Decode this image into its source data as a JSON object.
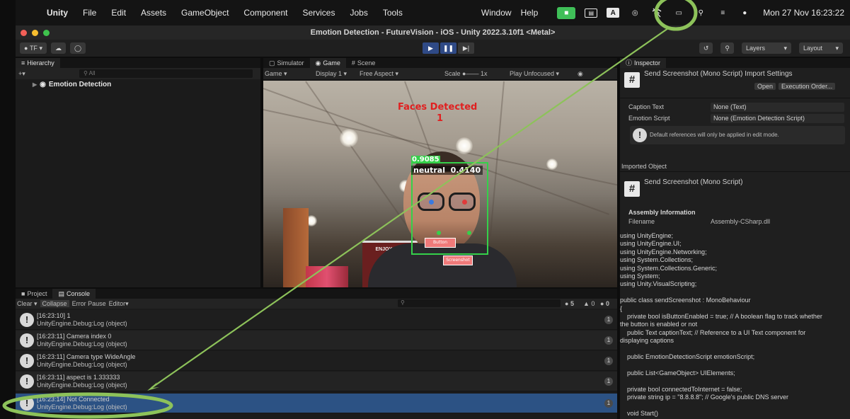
{
  "menubar": {
    "app": "Unity",
    "items": [
      "File",
      "Edit",
      "Assets",
      "GameObject",
      "Component",
      "Services",
      "Jobs",
      "Tools"
    ],
    "right_items": [
      "Window",
      "Help"
    ],
    "clock": "Mon 27 Nov  16:23:22"
  },
  "window": {
    "title": "Emotion Detection - FutureVision - iOS - Unity 2022.3.10f1 <Metal>"
  },
  "toolbar": {
    "account": "TF",
    "layers": "Layers",
    "layout": "Layout"
  },
  "hierarchy": {
    "tab": "Hierarchy",
    "search_placeholder": "All",
    "root_item": "Emotion Detection"
  },
  "game": {
    "tabs": [
      "Simulator",
      "Game",
      "Scene"
    ],
    "display_mode": "Game",
    "display": "Display 1",
    "aspect": "Free Aspect",
    "scale_label": "Scale",
    "scale_value": "1x",
    "play_mode": "Play Unfocused",
    "faces_detected_label": "Faces Detected",
    "faces_detected_count": "1",
    "face_score": "0.9085",
    "emotion": "neutral",
    "emotion_score": "0.4140",
    "button1": "Button",
    "button2": "Screenshot",
    "store_sign": "ENJOY OUR"
  },
  "console": {
    "tabs": [
      "Project",
      "Console"
    ],
    "toolbar": {
      "clear": "Clear",
      "collapse": "Collapse",
      "error_pause": "Error Pause",
      "editor": "Editor"
    },
    "counts": {
      "logs": "5",
      "warnings": "0",
      "errors": "0"
    },
    "rows": [
      {
        "line1": "[16:23:10] 1",
        "line2": "UnityEngine.Debug:Log (object)",
        "count": "1"
      },
      {
        "line1": "[16:23:11] Camera index 0",
        "line2": "UnityEngine.Debug:Log (object)",
        "count": "1"
      },
      {
        "line1": "[16:23:11] Camera type WideAngle",
        "line2": "UnityEngine.Debug:Log (object)",
        "count": "1"
      },
      {
        "line1": "[16:23:11] aspect is 1.333333",
        "line2": "UnityEngine.Debug:Log (object)",
        "count": "1"
      },
      {
        "line1": "[16:23:14] Not Connected",
        "line2": "UnityEngine.Debug:Log (object)",
        "count": "1"
      }
    ]
  },
  "inspector": {
    "tab": "Inspector",
    "header": "Send Screenshot (Mono Script) Import Settings",
    "open": "Open",
    "execution_order": "Execution Order...",
    "fields": [
      {
        "label": "Caption Text",
        "value": "None (Text)"
      },
      {
        "label": "Emotion Script",
        "value": "None (Emotion Detection Script)"
      }
    ],
    "help": "Default references will only be applied in edit mode.",
    "imported_object": "Imported Object",
    "script_title": "Send Screenshot (Mono Script)",
    "assembly_info": "Assembly Information",
    "filename_label": "Filename",
    "filename_value": "Assembly-CSharp.dll",
    "code": "using UnityEngine;\nusing UnityEngine.UI;\nusing UnityEngine.Networking;\nusing System.Collections;\nusing System.Collections.Generic;\nusing System;\nusing Unity.VisualScripting;\n\npublic class sendScreenshot : MonoBehaviour\n{\n    private bool isButtonEnabled = true; // A boolean flag to track whether\nthe button is enabled or not\n    public Text captionText; // Reference to a UI Text component for\ndisplaying captions\n\n    public EmotionDetectionScript emotionScript;\n\n    public List<GameObject> UIElements;\n\n    private bool connectedToInternet = false;\n    private string ip = \"8.8.8.8\"; // Google's public DNS server\n\n    void Start()"
  },
  "annotation_color": "#8dc25a"
}
